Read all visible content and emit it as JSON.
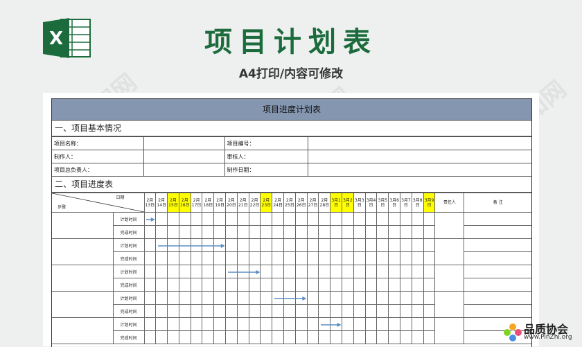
{
  "banner": {
    "title": "项目计划表",
    "subtitle": "A4打印/内容可修改",
    "logo_letter": "X",
    "brand_color": "#1b6b3d"
  },
  "document": {
    "header": "项目进度计划表",
    "section1": "一、项目基本情况",
    "info_rows": [
      {
        "l1": "项目名称：",
        "l2": "项目编号："
      },
      {
        "l1": "制作人：",
        "l2": "审核人："
      },
      {
        "l1": "项目总负责人：",
        "l2": "制作日期："
      }
    ],
    "section2": "二、项目进度表",
    "corner_date": "日期",
    "corner_step": "步骤",
    "dates": [
      "2月13日",
      "2月14日",
      "2月15日",
      "2月16日",
      "2月17日",
      "2月18日",
      "2月19日",
      "2月20日",
      "2月21日",
      "2月22日",
      "2月23日",
      "2月24日",
      "2月25日",
      "2月26日",
      "2月27日",
      "2月28日",
      "3月1日",
      "3月2日",
      "3月3日",
      "3月4日",
      "3月5日",
      "3月6日",
      "3月7日",
      "3月8日",
      "3月9日"
    ],
    "highlight_dates": [
      2,
      3,
      10,
      16,
      17,
      24
    ],
    "responsible_label": "责任人",
    "note_label": "备 注",
    "plan_label": "计划时间",
    "done_label": "完成时间",
    "highlight_color": "#ffff00",
    "header_color": "#8597b0"
  },
  "watermark": "觅知网",
  "brand": {
    "name": "品质协会",
    "url": "www.PinZhi.org"
  }
}
